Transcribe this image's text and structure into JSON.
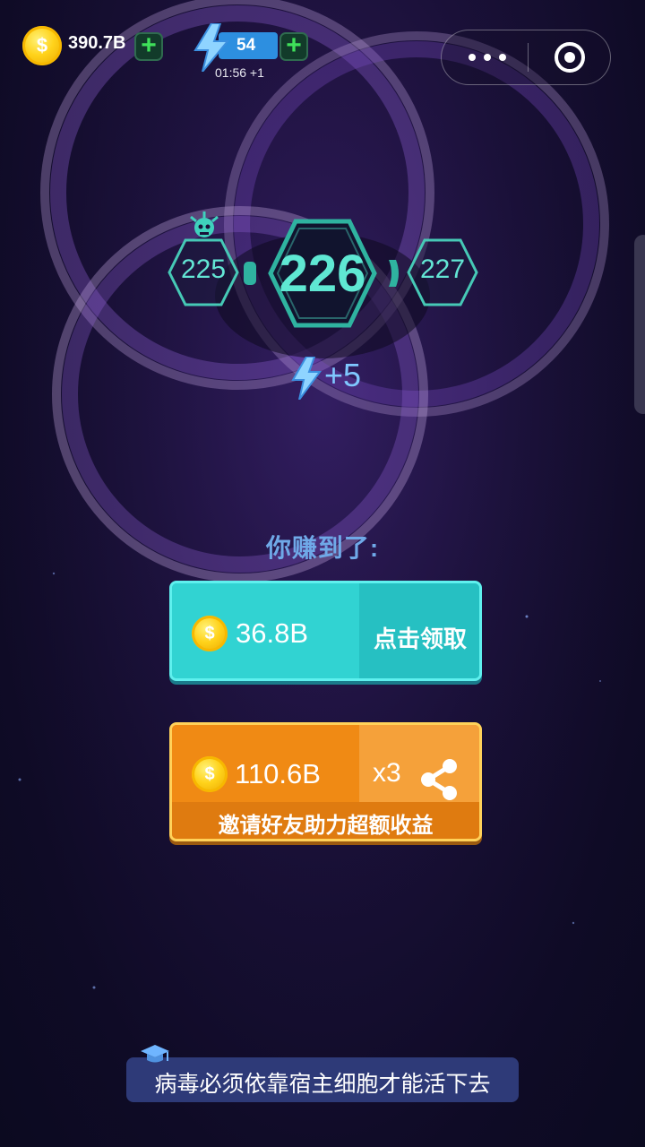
{
  "hud": {
    "coins": "390.7B",
    "coin_symbol": "$",
    "energy": "54",
    "energy_timer": "01:56 +1",
    "icons": {
      "coin": "coin-icon",
      "add": "plus-icon",
      "energy": "lightning-icon",
      "more": "more-dots-icon",
      "close": "target-close-icon"
    }
  },
  "level": {
    "previous": "225",
    "current": "226",
    "next": "227",
    "boss_icon": "virus-icon"
  },
  "reward": {
    "energy_bonus": "+5",
    "earned_label": "你赚到了:",
    "claim": {
      "amount": "36.8B",
      "label": "点击领取"
    },
    "share": {
      "amount": "110.6B",
      "multiplier": "x3",
      "subtitle": "邀请好友助力超额收益",
      "icon": "share-icon"
    }
  },
  "tip": {
    "text": "病毒必须依靠宿主细胞才能活下去",
    "icon": "graduation-cap-icon"
  },
  "colors": {
    "teal": "#5fe8d3",
    "claim_bg": "#31d3d2",
    "share_bg": "#f08a14",
    "energy_blue": "#2d8fe0",
    "tip_bg": "#2e3a78"
  }
}
